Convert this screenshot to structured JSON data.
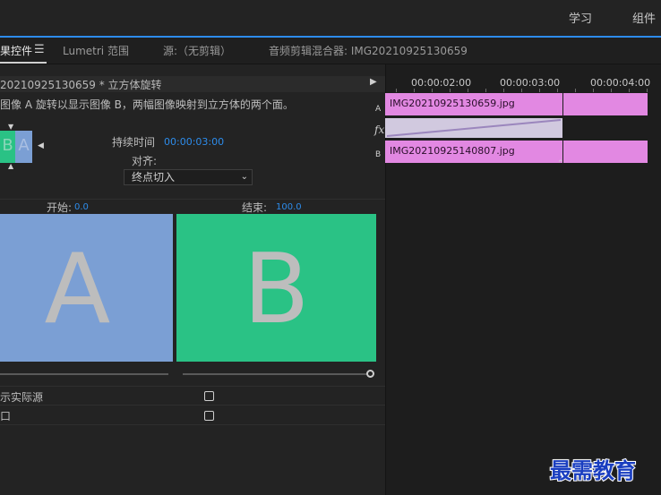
{
  "topbar": {
    "workspaces": [
      "学习",
      "组件"
    ]
  },
  "tabs": [
    {
      "label": "果控件",
      "active": true
    },
    {
      "label": "Lumetri 范围",
      "active": false
    },
    {
      "label": "源:（无剪辑）",
      "active": false
    },
    {
      "label": "音频剪辑混合器: IMG20210925130659",
      "active": false
    }
  ],
  "tab_menu_icon": "hamburger-menu-icon",
  "effect_controls": {
    "clip_header": "20210925130659 * 立方体旋转",
    "description": "图像 A 旋转以显示图像 B，两幅图像映射到立方体的两个面。",
    "thumb_letter_b": "B",
    "thumb_letter_a": "A",
    "duration_label": "持续时间",
    "duration_value": "00:00:03:00",
    "alignment_label": "对齐:",
    "alignment_value": "终点切入",
    "start_label": "开始:",
    "start_value": "0.0",
    "end_label": "结束:",
    "end_value": "100.0",
    "preview_a_letter": "A",
    "preview_b_letter": "B",
    "show_actual_sources_label": "示实际源",
    "reverse_label": "口",
    "colors": {
      "a": "#7b9fd4",
      "b": "#2ac285"
    }
  },
  "timeline": {
    "ruler_labels": [
      "00:00:02:00",
      "00:00:03:00",
      "00:00:04:00"
    ],
    "track_a_label": "A",
    "track_b_label": "B",
    "fx_label": "fx",
    "clip_a_name": "IMG20210925130659.jpg",
    "clip_b_name": "IMG20210925140807.jpg",
    "clip_color": "#e288e2"
  },
  "watermark": "最需教育"
}
